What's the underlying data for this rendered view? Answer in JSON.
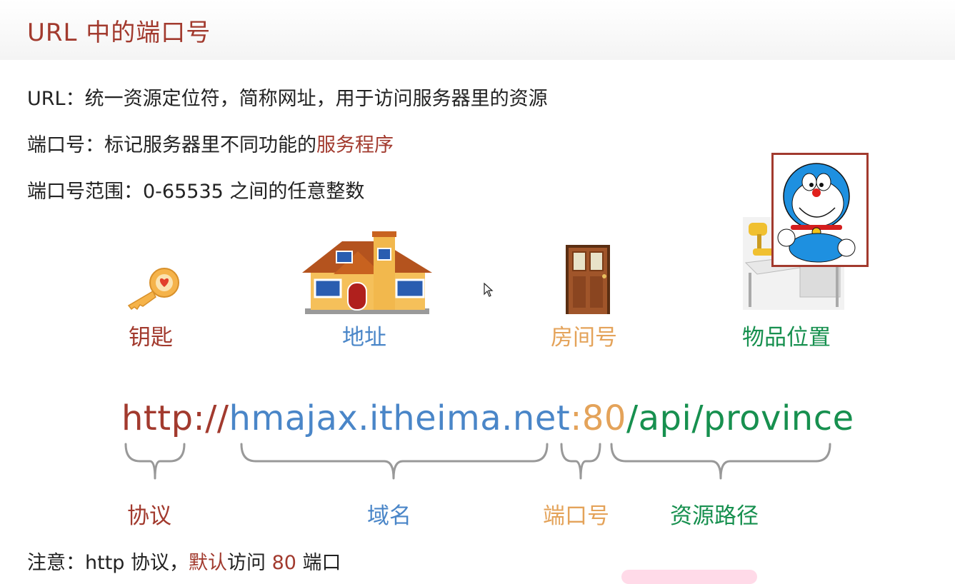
{
  "slide": {
    "title": "URL 中的端口号",
    "line1": "URL：统一资源定位符，简称网址，用于访问服务器里的资源",
    "line2_prefix": "端口号：标记服务器里不同功能的",
    "line2_highlight": "服务程序",
    "line3": "端口号范围：0-65535 之间的任意整数"
  },
  "analogy": {
    "key": "钥匙",
    "address": "地址",
    "room": "房间号",
    "location": "物品位置"
  },
  "url": {
    "protocol": "http://",
    "domain": "hmajax.itheima.net",
    "port": ":80",
    "path": "/api/province"
  },
  "segments": {
    "protocol": "协议",
    "domain": "域名",
    "port": "端口号",
    "path": "资源路径"
  },
  "note": {
    "prefix": "注意：http 协议，",
    "highlight": "默认",
    "middle": "访问 ",
    "port": "80",
    "suffix": " 端口"
  },
  "colors": {
    "red": "#a23a2e",
    "blue": "#4a86c8",
    "orange": "#e4a35a",
    "green": "#17904f"
  },
  "icons": [
    "key-icon",
    "house-icon",
    "door-icon",
    "desk-icon",
    "doraemon-icon",
    "cursor-icon"
  ]
}
